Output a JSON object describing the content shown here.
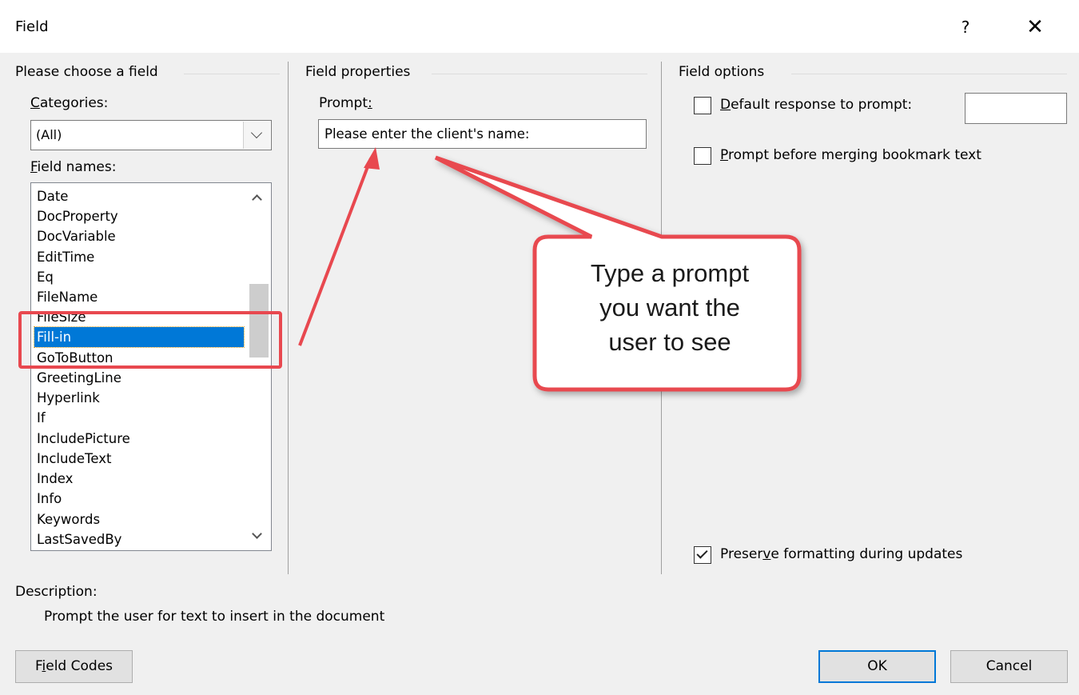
{
  "window": {
    "title": "Field",
    "help_label": "?",
    "close_label": "✕"
  },
  "left_panel": {
    "group_title": "Please choose a field",
    "categories_label": "Categories:",
    "categories_value": "(All)",
    "field_names_label": "Field names:",
    "field_names": [
      "Date",
      "DocProperty",
      "DocVariable",
      "EditTime",
      "Eq",
      "FileName",
      "FileSize",
      "Fill-in",
      "GoToButton",
      "GreetingLine",
      "Hyperlink",
      "If",
      "IncludePicture",
      "IncludeText",
      "Index",
      "Info",
      "Keywords",
      "LastSavedBy"
    ],
    "selected_field": "Fill-in"
  },
  "middle_panel": {
    "group_title": "Field properties",
    "prompt_label": "Prompt:",
    "prompt_value": "Please enter the client's name:"
  },
  "right_panel": {
    "group_title": "Field options",
    "default_response_label": "Default response to prompt:",
    "default_response_checked": false,
    "prompt_before_merging_label": "Prompt before merging bookmark text",
    "prompt_before_merging_checked": false,
    "preserve_formatting_label": "Preserve formatting during updates",
    "preserve_formatting_checked": true
  },
  "description": {
    "label": "Description:",
    "text": "Prompt the user for text to insert in the document"
  },
  "buttons": {
    "field_codes": "Field Codes",
    "ok": "OK",
    "cancel": "Cancel"
  },
  "annotation": {
    "callout_lines": [
      "Type a prompt",
      "you want the",
      "user to see"
    ],
    "color": "#e8484f"
  }
}
